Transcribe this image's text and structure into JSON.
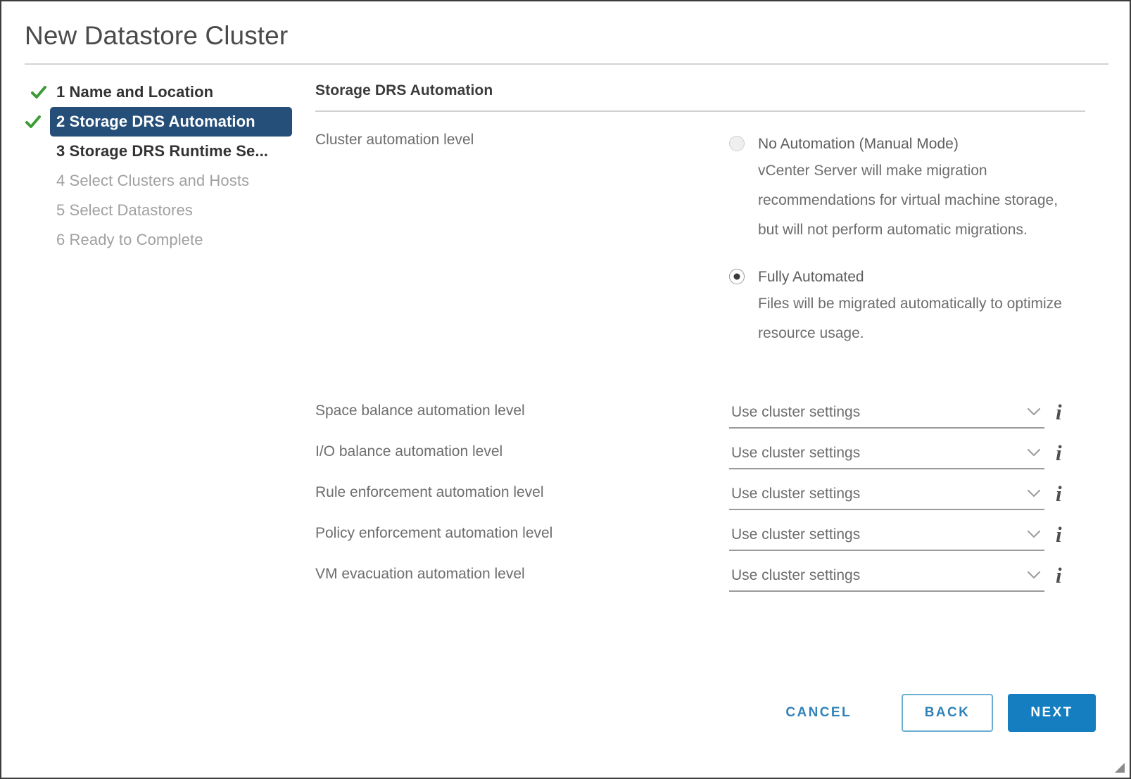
{
  "dialog": {
    "title": "New Datastore Cluster"
  },
  "wizard": {
    "steps": [
      {
        "label": "1 Name and Location",
        "state": "complete"
      },
      {
        "label": "2 Storage DRS Automation",
        "state": "active"
      },
      {
        "label": "3 Storage DRS Runtime Se...",
        "state": "enabled"
      },
      {
        "label": "4 Select Clusters and Hosts",
        "state": "disabled"
      },
      {
        "label": "5 Select Datastores",
        "state": "disabled"
      },
      {
        "label": "6 Ready to Complete",
        "state": "disabled"
      }
    ]
  },
  "panel": {
    "heading": "Storage DRS Automation",
    "cluster_automation": {
      "label": "Cluster automation level",
      "options": [
        {
          "title": "No Automation (Manual Mode)",
          "description": "vCenter Server will make migration recommendations for virtual machine storage, but will not perform automatic migrations.",
          "selected": false
        },
        {
          "title": "Fully Automated",
          "description": "Files will be migrated automatically to optimize resource usage.",
          "selected": true
        }
      ]
    },
    "fields": [
      {
        "label": "Space balance automation level",
        "value": "Use cluster settings",
        "info": "i"
      },
      {
        "label": "I/O balance automation level",
        "value": "Use cluster settings",
        "info": "i"
      },
      {
        "label": "Rule enforcement automation level",
        "value": "Use cluster settings",
        "info": "i"
      },
      {
        "label": "Policy enforcement automation level",
        "value": "Use cluster settings",
        "info": "i"
      },
      {
        "label": "VM evacuation automation level",
        "value": "Use cluster settings",
        "info": "i"
      }
    ]
  },
  "footer": {
    "cancel_label": "CANCEL",
    "back_label": "BACK",
    "next_label": "NEXT"
  },
  "colors": {
    "accent_blue": "#157ec0",
    "nav_active_bg": "#254e78",
    "check_green": "#3c9c35",
    "link_blue": "#3182b8",
    "label_gray": "#6d6d6d"
  }
}
